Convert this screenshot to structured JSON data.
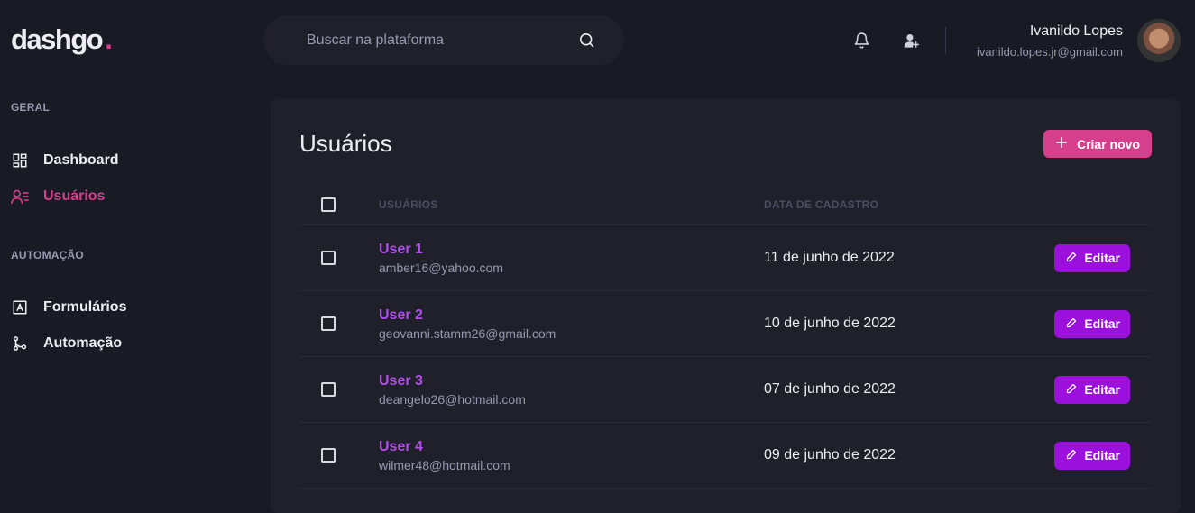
{
  "brand": {
    "name": "dashgo",
    "dot": "."
  },
  "search": {
    "placeholder": "Buscar na plataforma",
    "value": ""
  },
  "header": {
    "icons": [
      "bell-icon",
      "user-add-icon"
    ],
    "profile": {
      "name": "Ivanildo Lopes",
      "email": "ivanildo.lopes.jr@gmail.com"
    }
  },
  "sidebar": {
    "sections": [
      {
        "title": "GERAL",
        "items": [
          {
            "label": "Dashboard",
            "icon": "dashboard-icon",
            "active": false
          },
          {
            "label": "Usuários",
            "icon": "users-icon",
            "active": true
          }
        ]
      },
      {
        "title": "AUTOMAÇÃO",
        "items": [
          {
            "label": "Formulários",
            "icon": "form-icon",
            "active": false
          },
          {
            "label": "Automação",
            "icon": "git-merge-icon",
            "active": false
          }
        ]
      }
    ]
  },
  "main": {
    "title": "Usuários",
    "create_button": "Criar novo",
    "table": {
      "columns": [
        "USUÁRIOS",
        "DATA DE CADASTRO"
      ],
      "rows": [
        {
          "name": "User 1",
          "email": "amber16@yahoo.com",
          "date": "11 de junho de 2022",
          "action": "Editar"
        },
        {
          "name": "User 2",
          "email": "geovanni.stamm26@gmail.com",
          "date": "10 de junho de 2022",
          "action": "Editar"
        },
        {
          "name": "User 3",
          "email": "deangelo26@hotmail.com",
          "date": "07 de junho de 2022",
          "action": "Editar"
        },
        {
          "name": "User 4",
          "email": "wilmer48@hotmail.com",
          "date": "09 de junho de 2022",
          "action": "Editar"
        }
      ]
    }
  },
  "colors": {
    "accent": "#d53f8c",
    "purple": "#9b10dc",
    "background": "#181b23",
    "panel": "#1f2029"
  }
}
